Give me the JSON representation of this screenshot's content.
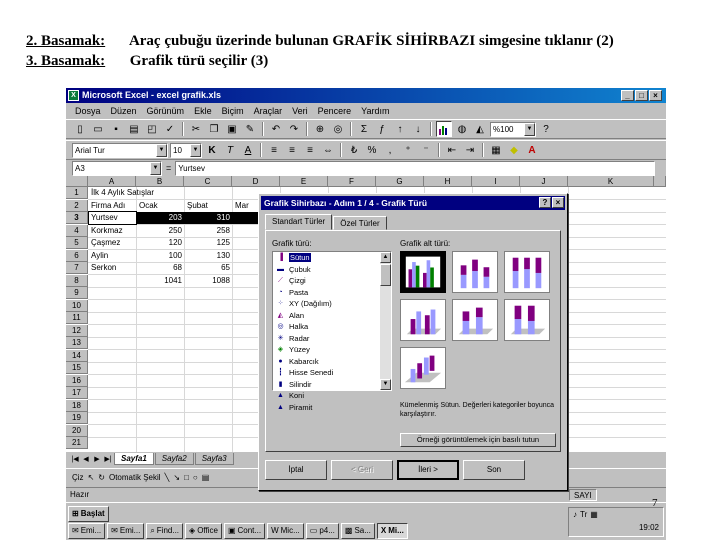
{
  "slide": {
    "step2_label": "2. Basamak:",
    "step2_text": "Araç çubuğu üzerinde bulunan GRAFİK SİHİRBAZI simgesine tıklanır (2)",
    "step3_label": "3. Basamak:",
    "step3_text": "Grafik türü seçilir (3)",
    "page_number": "7"
  },
  "excel": {
    "title": "Microsoft Excel - excel grafik.xls",
    "menus": [
      "Dosya",
      "Düzen",
      "Görünüm",
      "Ekle",
      "Biçim",
      "Araçlar",
      "Veri",
      "Pencere",
      "Yardım"
    ],
    "zoom": "%100",
    "font_name": "Arial Tur",
    "font_size": "10",
    "name_box": "A3",
    "formula_value": "Yurtsev",
    "columns": [
      "A",
      "B",
      "C",
      "D",
      "E",
      "F",
      "G",
      "H",
      "I",
      "J",
      "K"
    ],
    "rows": [
      "1",
      "2",
      "3",
      "4",
      "5",
      "6",
      "7",
      "8",
      "9",
      "10",
      "11",
      "12",
      "13",
      "14",
      "15",
      "16",
      "17",
      "18",
      "19",
      "20",
      "21"
    ],
    "cells": {
      "r1": [
        "İlk 4 Aylık Satışlar"
      ],
      "r2": [
        "Firma Adı",
        "Ocak",
        "Şubat",
        "Mar"
      ],
      "r3": [
        "Yurtsev",
        "203",
        "310"
      ],
      "r4": [
        "Korkmaz",
        "250",
        "258"
      ],
      "r5": [
        "Çaşmez",
        "120",
        "125"
      ],
      "r6": [
        "Aylin",
        "100",
        "130"
      ],
      "r7": [
        "Serkon",
        "68",
        "65"
      ],
      "r8": [
        "",
        "1041",
        "1088"
      ]
    },
    "sheets": [
      "Sayfa1",
      "Sayfa2",
      "Sayfa3"
    ],
    "draw_label": "Çiz",
    "autoshapes_label": "Otomatik Şekil",
    "status_left": "Hazır",
    "status_num": "SAYI",
    "taskbar": {
      "start": "Başlat",
      "tasks": [
        "Emi...",
        "Emi...",
        "Find...",
        "Office",
        "Cont...",
        "Mic...",
        "p4...",
        "Sa...",
        "Mi..."
      ],
      "clock": "19:02"
    }
  },
  "dialog": {
    "title": "Grafik Sihirbazı - Adım 1 / 4 - Grafik Türü",
    "tabs": [
      "Standart Türler",
      "Özel Türler"
    ],
    "types_label": "Grafik türü:",
    "subtypes_label": "Grafik alt türü:",
    "chart_types": [
      {
        "label": "Sütun",
        "icon": "column-chart-icon"
      },
      {
        "label": "Çubuk",
        "icon": "bar-chart-icon"
      },
      {
        "label": "Çizgi",
        "icon": "line-chart-icon"
      },
      {
        "label": "Pasta",
        "icon": "pie-chart-icon"
      },
      {
        "label": "XY (Dağılım)",
        "icon": "scatter-chart-icon"
      },
      {
        "label": "Alan",
        "icon": "area-chart-icon"
      },
      {
        "label": "Halka",
        "icon": "doughnut-chart-icon"
      },
      {
        "label": "Radar",
        "icon": "radar-chart-icon"
      },
      {
        "label": "Yüzey",
        "icon": "surface-chart-icon"
      },
      {
        "label": "Kabarcık",
        "icon": "bubble-chart-icon"
      },
      {
        "label": "Hisse Senedi",
        "icon": "stock-chart-icon"
      },
      {
        "label": "Silindir",
        "icon": "cylinder-chart-icon"
      },
      {
        "label": "Koni",
        "icon": "cone-chart-icon"
      },
      {
        "label": "Piramit",
        "icon": "pyramid-chart-icon"
      }
    ],
    "description": "Kümelenmiş Sütun. Değerleri kategoriler boyunca karşılaştırır.",
    "preview_button": "Örneği görüntülemek için basılı tutun",
    "buttons": [
      "İptal",
      "< Geri",
      "İleri >",
      "Son"
    ],
    "colors": {
      "series1": "#800080",
      "series2": "#9999ff",
      "series3": "#008000",
      "titlebar": "#000080"
    }
  }
}
